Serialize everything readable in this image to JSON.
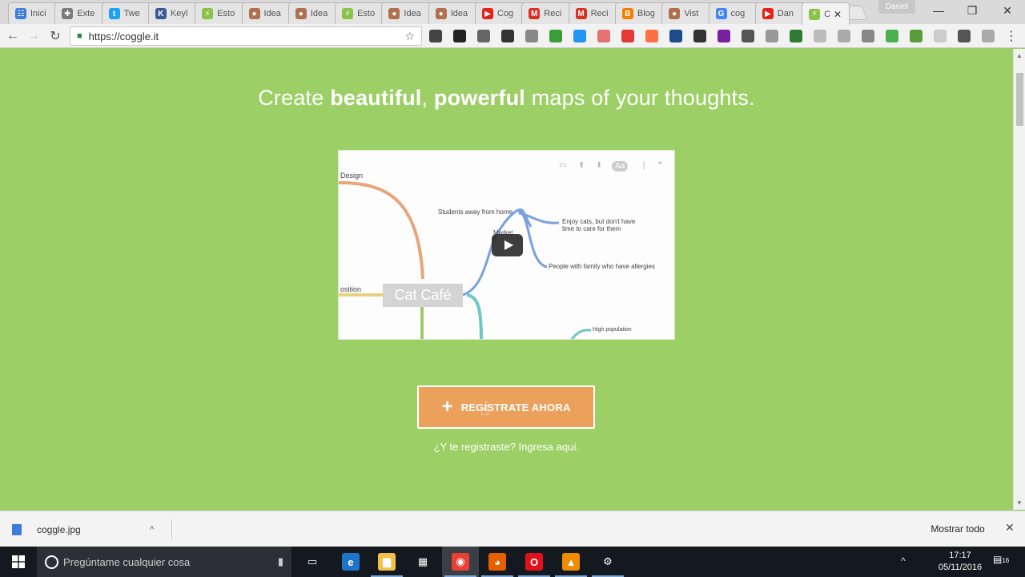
{
  "tabs": [
    {
      "label": "Inici",
      "color": "#3b7dd8",
      "glyph": "☷"
    },
    {
      "label": "Exte",
      "color": "#7a7a7a",
      "glyph": "✚"
    },
    {
      "label": "Twe",
      "color": "#1da1f2",
      "glyph": "t"
    },
    {
      "label": "Keyl",
      "color": "#3b5998",
      "glyph": "K"
    },
    {
      "label": "Esto",
      "color": "#8bc34a",
      "glyph": "⚡"
    },
    {
      "label": "Idea",
      "color": "#b07050",
      "glyph": "●"
    },
    {
      "label": "Idea",
      "color": "#b07050",
      "glyph": "●"
    },
    {
      "label": "Esto",
      "color": "#8bc34a",
      "glyph": "⚡"
    },
    {
      "label": "Idea",
      "color": "#b07050",
      "glyph": "●"
    },
    {
      "label": "Idea",
      "color": "#b07050",
      "glyph": "●"
    },
    {
      "label": "Cog",
      "color": "#e62117",
      "glyph": "▶"
    },
    {
      "label": "Reci",
      "color": "#d93025",
      "glyph": "M"
    },
    {
      "label": "Reci",
      "color": "#d93025",
      "glyph": "M"
    },
    {
      "label": "Blog",
      "color": "#f57d00",
      "glyph": "B"
    },
    {
      "label": "Vist",
      "color": "#b07050",
      "glyph": "●"
    },
    {
      "label": "cog",
      "color": "#4285f4",
      "glyph": "G"
    },
    {
      "label": "Dan",
      "color": "#e62117",
      "glyph": "▶"
    },
    {
      "label": "C",
      "color": "#8bc34a",
      "glyph": "⚡",
      "active": true
    }
  ],
  "window": {
    "profile": "Daniel",
    "minimize": "—",
    "restore": "❐",
    "close": "✕"
  },
  "toolbar": {
    "back": "←",
    "forward": "→",
    "reload": "↻",
    "url": "https://coggle.it",
    "lock": "🔒",
    "bookmark": "☆",
    "menu": "⋮",
    "extension_colors": [
      "#444",
      "#222",
      "#666",
      "#333",
      "#888",
      "#3a9d3a",
      "#2196f3",
      "#e57373",
      "#e53935",
      "#ff7043",
      "#1e4c8a",
      "#333",
      "#7b1fa2",
      "#555",
      "#999",
      "#2e7d32",
      "#bbb",
      "#aaa",
      "#888",
      "#4caf50",
      "#5a9b3a",
      "#ccc",
      "#555",
      "#aaa"
    ]
  },
  "page": {
    "headline_pre": "Create ",
    "headline_b1": "beautiful",
    "headline_comma": ", ",
    "headline_b2": "powerful",
    "headline_post": " maps of your thoughts.",
    "signup_label": "REGÍSTRATE AHORA",
    "signup_plus": "+",
    "login_link": "¿Y te registraste? Ingresa aquí."
  },
  "video": {
    "center_node": "Cat Café",
    "labels": {
      "design": "Design",
      "position": "osition",
      "students": "Students away from home",
      "market": "Market",
      "enjoy_line1": "Enjoy cats, but don't have",
      "enjoy_line2": "time to care for them",
      "people": "People with family who have allergies",
      "high_pop": "High population"
    },
    "tools": [
      "▭",
      "⬆",
      "⬇",
      "Aa",
      "❘",
      "❞"
    ]
  },
  "download": {
    "filename": "coggle.jpg",
    "chevron": "^",
    "show_all": "Mostrar todo",
    "close": "✕"
  },
  "taskbar": {
    "search_placeholder": "Pregúntame cualquier cosa",
    "mic": "🎙",
    "time": "17:17",
    "date": "05/11/2016",
    "tray_chevron": "^",
    "notifications": "16",
    "apps": [
      {
        "name": "task-view",
        "glyph": "▭",
        "color": "#14191f"
      },
      {
        "name": "edge",
        "glyph": "e",
        "color": "#1e74c9"
      },
      {
        "name": "explorer",
        "glyph": "▆",
        "color": "#f2c14a"
      },
      {
        "name": "store",
        "glyph": "▦",
        "color": "#14191f"
      },
      {
        "name": "chrome",
        "glyph": "◉",
        "color": "#e94235"
      },
      {
        "name": "firefox",
        "glyph": "◕",
        "color": "#e66000"
      },
      {
        "name": "opera",
        "glyph": "O",
        "color": "#e0111b"
      },
      {
        "name": "vlc",
        "glyph": "▲",
        "color": "#f08c00"
      },
      {
        "name": "settings",
        "glyph": "⚙",
        "color": "#14191f"
      }
    ]
  }
}
